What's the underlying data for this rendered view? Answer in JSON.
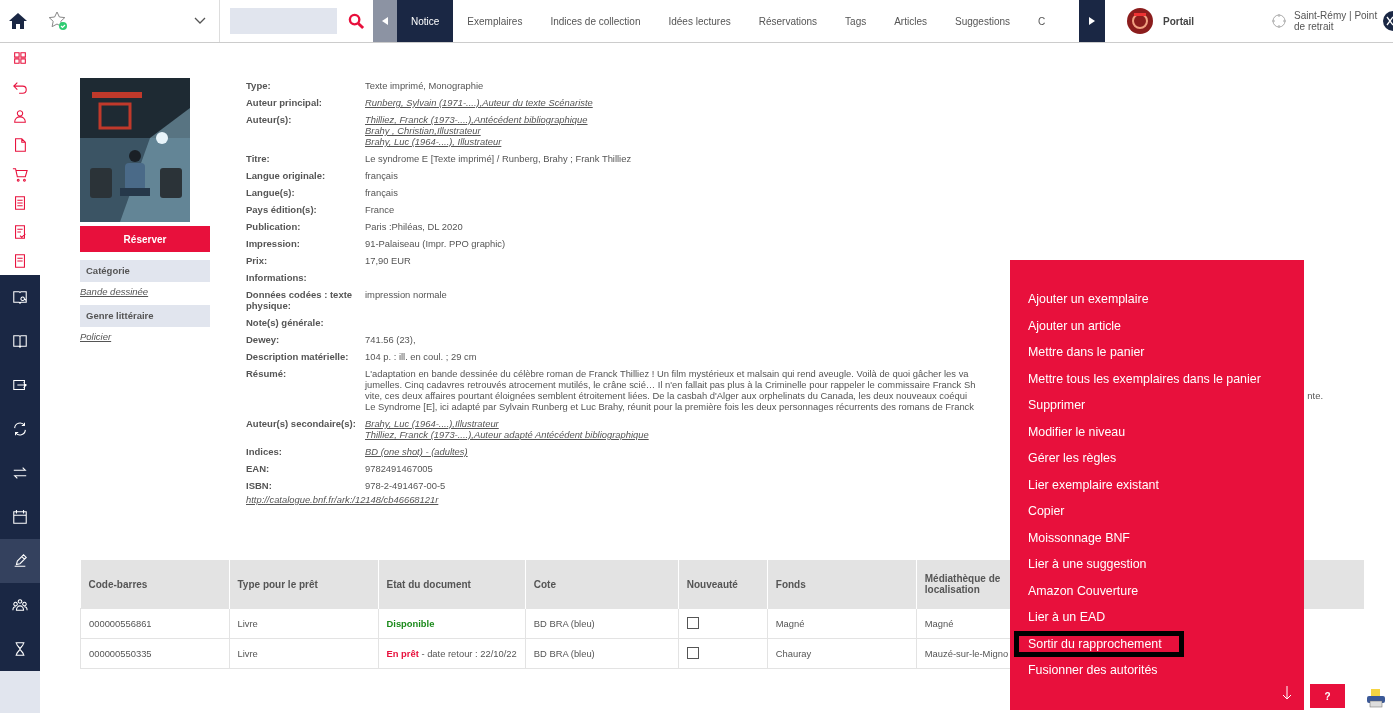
{
  "top_bar": {
    "tabs": [
      {
        "label": "Notice",
        "selected": true
      },
      {
        "label": "Exemplaires",
        "selected": false
      },
      {
        "label": "Indices de collection",
        "selected": false
      },
      {
        "label": "Idées lectures",
        "selected": false
      },
      {
        "label": "Réservations",
        "selected": false
      },
      {
        "label": "Tags",
        "selected": false
      },
      {
        "label": "Articles",
        "selected": false
      },
      {
        "label": "Suggestions",
        "selected": false
      },
      {
        "label": "C",
        "selected": false
      }
    ],
    "portal": "Portail",
    "location": "Saint-Rémy | Point de retrait"
  },
  "sidebar": {
    "items": [
      {
        "selected": false
      },
      {
        "selected": false
      },
      {
        "selected": false
      },
      {
        "selected": false
      },
      {
        "selected": false
      },
      {
        "selected": false
      },
      {
        "selected": false
      },
      {
        "selected": false
      },
      {
        "selected": false
      },
      {
        "selected": false
      },
      {
        "selected": false
      },
      {
        "selected": false
      },
      {
        "selected": false
      },
      {
        "selected": false
      },
      {
        "selected": true
      },
      {
        "selected": false
      },
      {
        "selected": false
      }
    ]
  },
  "record": {
    "reserve_button": "Réserver",
    "categories": [
      {
        "heading": "Catégorie",
        "value": "Bande dessinée"
      },
      {
        "heading": "Genre littéraire",
        "value": "Policier"
      }
    ],
    "fields": [
      {
        "label": "Type:",
        "values": [
          {
            "text": "Texte imprimé, Monographie",
            "link": false
          }
        ]
      },
      {
        "label": "Auteur principal:",
        "values": [
          {
            "text": "Runberg, Sylvain (1971-....),Auteur du texte Scénariste",
            "link": true
          }
        ]
      },
      {
        "label": "Auteur(s):",
        "values": [
          {
            "text": "Thilliez, Franck (1973-....),Antécédent bibliographique",
            "link": true
          },
          {
            "text": "Brahy , Christian,Illustrateur",
            "link": true
          },
          {
            "text": "Brahy, Luc (1964-....), Illustrateur",
            "link": true
          }
        ]
      },
      {
        "label": "Titre:",
        "values": [
          {
            "text": "Le syndrome E [Texte imprimé] / Runberg, Brahy ; Frank Thilliez",
            "link": false
          }
        ]
      },
      {
        "label": "Langue originale:",
        "values": [
          {
            "text": "français",
            "link": false
          }
        ]
      },
      {
        "label": "Langue(s):",
        "values": [
          {
            "text": "français",
            "link": false
          }
        ]
      },
      {
        "label": "Pays édition(s):",
        "values": [
          {
            "text": "France",
            "link": false
          }
        ]
      },
      {
        "label": "Publication:",
        "values": [
          {
            "text": "Paris :Philéas, DL 2020",
            "link": false
          }
        ]
      },
      {
        "label": "Impression:",
        "values": [
          {
            "text": "91-Palaiseau (Impr. PPO graphic)",
            "link": false
          }
        ]
      },
      {
        "label": "Prix:",
        "values": [
          {
            "text": "17,90 EUR",
            "link": false
          }
        ]
      },
      {
        "label": "Informations:"
      },
      {
        "label": "Données codées : texte physique:",
        "values": [
          {
            "text": "impression normale",
            "link": false
          }
        ]
      },
      {
        "label": "Note(s) générale:"
      },
      {
        "label": "Dewey:",
        "values": [
          {
            "text": "741.56 (23),",
            "link": false
          }
        ]
      },
      {
        "label": "Description matérielle:",
        "values": [
          {
            "text": "104 p. : ill. en coul. ; 29 cm",
            "link": false
          }
        ]
      },
      {
        "label": "Résumé:",
        "values": [
          {
            "text": "L'adaptation en bande dessinée du célèbre roman de Franck Thilliez ! Un film mystérieux et malsain qui rend aveugle. Voilà de quoi gâcher les va",
            "link": false
          },
          {
            "text": "jumelles. Cinq cadavres retrouvés atrocement mutilés, le crâne scié… Il n'en fallait pas plus à la Criminelle pour rappeler le commissaire Franck Sh",
            "link": false
          },
          {
            "text": "vite, ces deux affaires pourtant éloignées semblent étroitement liées. De la casbah d'Alger aux orphelinats du Canada, les deux nouveaux coéqui",
            "link": false
          },
          {
            "text": "Le Syndrome [E], ici adapté par Sylvain Runberg et Luc Brahy, réunit pour la première fois les deux personnages récurrents des romans de Franck",
            "link": false
          }
        ]
      },
      {
        "label": "Auteur(s) secondaire(s):",
        "values": [
          {
            "text": "Brahy, Luc (1964-....),Illustrateur",
            "link": true
          },
          {
            "text": "Thilliez, Franck (1973-....),Auteur adapté Antécédent bibliographique",
            "link": true
          }
        ]
      },
      {
        "label": "Indices:",
        "values": [
          {
            "text": "BD (one shot) - (adultes)",
            "link": true
          }
        ]
      },
      {
        "label": "EAN:",
        "values": [
          {
            "text": "9782491467005",
            "link": false
          }
        ]
      },
      {
        "label": "ISBN:",
        "values": [
          {
            "text": "978-2-491467-00-5",
            "link": false
          }
        ]
      }
    ],
    "resume_tail": "nte.",
    "catalogue_link": "http://catalogue.bnf.fr/ark:/12148/cb46668121r"
  },
  "copies": {
    "columns": [
      "Code-barres",
      "Type pour le prêt",
      "Etat du document",
      "Cote",
      "Nouveauté",
      "Fonds",
      "Médiathèque de localisation"
    ],
    "rows": [
      {
        "barcode": "000000556861",
        "loan_type": "Livre",
        "status": {
          "kind": "available",
          "label": "Disponible"
        },
        "shelfmark": "BD BRA (bleu)",
        "new": false,
        "collection": "Magné",
        "library": "Magné"
      },
      {
        "barcode": "000000550335",
        "loan_type": "Livre",
        "status": {
          "kind": "on_loan",
          "label": "En prêt",
          "detail": " - date retour : 22/10/22"
        },
        "shelfmark": "BD BRA (bleu)",
        "new": false,
        "collection": "Chauray",
        "library": "Mauzé-sur-le-Migno"
      }
    ]
  },
  "action_menu": {
    "items": [
      {
        "label": "Ajouter un exemplaire",
        "selected": false
      },
      {
        "label": "Ajouter un article",
        "selected": false
      },
      {
        "label": "Mettre dans le panier",
        "selected": false
      },
      {
        "label": "Mettre tous les exemplaires dans le panier",
        "selected": false
      },
      {
        "label": "Supprimer",
        "selected": false
      },
      {
        "label": "Modifier le niveau",
        "selected": false
      },
      {
        "label": "Gérer les règles",
        "selected": false
      },
      {
        "label": "Lier exemplaire existant",
        "selected": false
      },
      {
        "label": "Copier",
        "selected": false
      },
      {
        "label": "Moissonnage BNF",
        "selected": false
      },
      {
        "label": "Lier à une suggestion",
        "selected": false
      },
      {
        "label": "Amazon Couverture",
        "selected": false
      },
      {
        "label": "Lier à un EAD",
        "selected": false
      },
      {
        "label": "Sortir du rapprochement",
        "selected": true
      },
      {
        "label": "Fusionner des autorités",
        "selected": false
      }
    ]
  },
  "help_button": "?"
}
